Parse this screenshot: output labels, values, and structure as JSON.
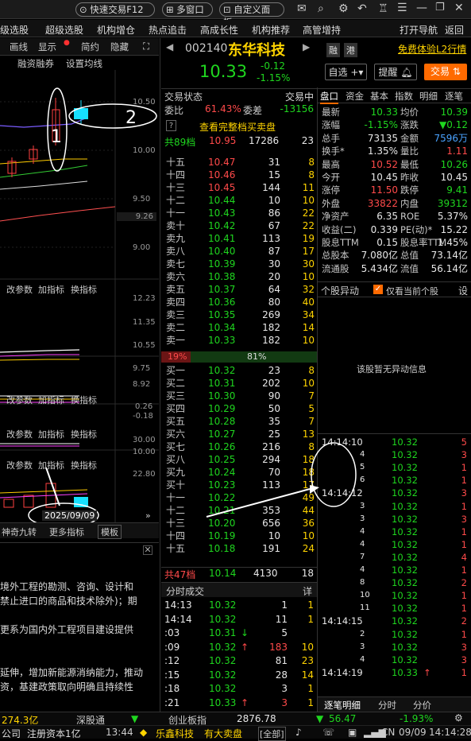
{
  "top": {
    "quick_trade": "快速交易F12",
    "multi_window": "多窗口",
    "custom_panel": "自定义面板"
  },
  "toolbar2": {
    "items": [
      "级选股",
      "超级选股",
      "机构增仓",
      "热点追击",
      "高成长性",
      "机构推荐",
      "高管增持"
    ],
    "open_nav": "打开导航",
    "back": "返回"
  },
  "chart_toolbar": {
    "items": [
      "画线",
      "显示",
      "简约",
      "隐藏"
    ],
    "sub": "融资融券",
    "sub2": "设置均线"
  },
  "chart": {
    "price_ticks": [
      "10.50",
      "10.00",
      "9.50",
      "9.26",
      "9.00"
    ],
    "ind_ticks": [
      "12.23",
      "11.35",
      "10.55",
      "9.75",
      "8.92"
    ],
    "macd_ticks": [
      "0.26",
      "-0.18"
    ],
    "vol_ticks": [
      "30.00",
      "10.00"
    ],
    "vol2_ticks": [
      "22.80"
    ],
    "panel_labels": [
      "改参数",
      "加指标",
      "换指标"
    ],
    "date": "2025/09/09",
    "bottom_left": "神奇九转",
    "more": "更多指标",
    "plate": "模板",
    "annotations": [
      "1",
      "2"
    ]
  },
  "text_panel": {
    "lines": [
      "境外工程的勘测、咨询、设计和",
      "禁止进口的商品和技术除外)；期",
      "",
      "更系为国内外工程项目建设提供",
      "",
      "",
      "延伸，增加新能源消纳能力，推动",
      "资，基建政策取向明确且持续性"
    ]
  },
  "stock": {
    "code": "002140",
    "name": "东华科技",
    "price": "10.33",
    "change": "-0.12",
    "pct": "-1.15%",
    "rong": "融",
    "gang": "港",
    "free_l2": "免费体验L2行情"
  },
  "actions": {
    "watch": "自选",
    "remind": "提醒",
    "trade": "交易"
  },
  "trade_status": {
    "label": "交易状态",
    "value": "交易中"
  },
  "ratio": {
    "weibi_label": "委比",
    "weibi": "61.43%",
    "weicha_label": "委差",
    "weicha": "-13156"
  },
  "view_full": "查看完整档买卖盘",
  "ask_total": {
    "label": "共89档",
    "price": "10.95",
    "vol": "17286",
    "cnt": "23"
  },
  "asks": [
    {
      "l": "十五",
      "p": "10.47",
      "v": "31",
      "c": "8"
    },
    {
      "l": "十四",
      "p": "10.46",
      "v": "15",
      "c": "8"
    },
    {
      "l": "十三",
      "p": "10.45",
      "v": "144",
      "c": "11"
    },
    {
      "l": "十二",
      "p": "10.44",
      "v": "10",
      "c": "10"
    },
    {
      "l": "十一",
      "p": "10.43",
      "v": "86",
      "c": "22"
    },
    {
      "l": "卖十",
      "p": "10.42",
      "v": "67",
      "c": "22"
    },
    {
      "l": "卖九",
      "p": "10.41",
      "v": "113",
      "c": "19"
    },
    {
      "l": "卖八",
      "p": "10.40",
      "v": "87",
      "c": "17"
    },
    {
      "l": "卖七",
      "p": "10.39",
      "v": "30",
      "c": "30"
    },
    {
      "l": "卖六",
      "p": "10.38",
      "v": "20",
      "c": "10"
    },
    {
      "l": "卖五",
      "p": "10.37",
      "v": "64",
      "c": "32"
    },
    {
      "l": "卖四",
      "p": "10.36",
      "v": "80",
      "c": "40"
    },
    {
      "l": "卖三",
      "p": "10.35",
      "v": "269",
      "c": "34"
    },
    {
      "l": "卖二",
      "p": "10.34",
      "v": "182",
      "c": "14"
    },
    {
      "l": "卖一",
      "p": "10.33",
      "v": "182",
      "c": "10"
    }
  ],
  "power": {
    "left": "19%",
    "right": "81%"
  },
  "bids": [
    {
      "l": "买一",
      "p": "10.32",
      "v": "23",
      "c": "8"
    },
    {
      "l": "买二",
      "p": "10.31",
      "v": "202",
      "c": "10"
    },
    {
      "l": "买三",
      "p": "10.30",
      "v": "90",
      "c": "7"
    },
    {
      "l": "买四",
      "p": "10.29",
      "v": "50",
      "c": "5"
    },
    {
      "l": "买五",
      "p": "10.28",
      "v": "35",
      "c": "7"
    },
    {
      "l": "买六",
      "p": "10.27",
      "v": "25",
      "c": "13"
    },
    {
      "l": "买七",
      "p": "10.26",
      "v": "216",
      "c": "8"
    },
    {
      "l": "买八",
      "p": "10.25",
      "v": "294",
      "c": "18"
    },
    {
      "l": "买九",
      "p": "10.24",
      "v": "70",
      "c": "18"
    },
    {
      "l": "买十",
      "p": "10.23",
      "v": "113",
      "c": "17"
    },
    {
      "l": "十一",
      "p": "10.22",
      "v": "",
      "c": "49"
    },
    {
      "l": "十二",
      "p": "10.21",
      "v": "353",
      "c": "44"
    },
    {
      "l": "十三",
      "p": "10.20",
      "v": "656",
      "c": "36"
    },
    {
      "l": "十四",
      "p": "10.19",
      "v": "10",
      "c": "10"
    },
    {
      "l": "十五",
      "p": "10.18",
      "v": "191",
      "c": "24"
    }
  ],
  "bid_total": {
    "label": "共47档",
    "price": "10.14",
    "vol": "4130",
    "cnt": "18"
  },
  "timesales": {
    "title": "分时成交",
    "detail": "详",
    "rows": [
      {
        "t": "14:13",
        "p": "10.32",
        "v": "1",
        "c": "1",
        "pc": "grn"
      },
      {
        "t": "14:14",
        "p": "10.32",
        "v": "11",
        "c": "1",
        "pc": "grn"
      },
      {
        "t": ":03",
        "p": "10.31",
        "v": "5",
        "c": "",
        "pc": "grn",
        "arrow": "down"
      },
      {
        "t": ":09",
        "p": "10.32",
        "v": "183",
        "c": "10",
        "pc": "grn",
        "arrow": "up"
      },
      {
        "t": ":12",
        "p": "10.32",
        "v": "81",
        "c": "23",
        "pc": "grn"
      },
      {
        "t": ":15",
        "p": "10.32",
        "v": "28",
        "c": "14",
        "pc": "grn"
      },
      {
        "t": ":18",
        "p": "10.32",
        "v": "3",
        "c": "1",
        "pc": "grn"
      },
      {
        "t": ":21",
        "p": "10.33",
        "v": "3",
        "c": "1",
        "pc": "grn",
        "arrow": "up"
      }
    ]
  },
  "right_tabs": [
    "盘口",
    "资金",
    "基本",
    "指数",
    "明细",
    "逐笔"
  ],
  "quote": [
    {
      "a": "最新",
      "b": "10.33",
      "bc": "grn",
      "c": "均价",
      "d": "10.39",
      "dc": "grn"
    },
    {
      "a": "涨幅",
      "b": "-1.15%",
      "bc": "grn",
      "c": "涨跌",
      "d": "▼0.12",
      "dc": "grn"
    },
    {
      "a": "总手",
      "b": "73135",
      "bc": "wht",
      "c": "金额",
      "d": "7596万",
      "dc": "blu"
    },
    {
      "a": "换手*",
      "b": "1.35%",
      "bc": "wht",
      "c": "量比",
      "d": "1.11",
      "dc": "red"
    },
    {
      "a": "最高",
      "b": "10.52",
      "bc": "red",
      "c": "最低",
      "d": "10.26",
      "dc": "grn"
    },
    {
      "a": "今开",
      "b": "10.45",
      "bc": "wht",
      "c": "昨收",
      "d": "10.45",
      "dc": "wht"
    },
    {
      "a": "涨停",
      "b": "11.50",
      "bc": "red",
      "c": "跌停",
      "d": "9.41",
      "dc": "grn"
    },
    {
      "a": "外盘",
      "b": "33822",
      "bc": "red",
      "c": "内盘",
      "d": "39312",
      "dc": "grn"
    },
    {
      "a": "净资产",
      "b": "6.35",
      "bc": "wht",
      "c": "ROE",
      "d": "5.37%",
      "dc": "wht"
    },
    {
      "a": "收益(二)",
      "b": "0.339",
      "bc": "wht",
      "c": "PE(动)*",
      "d": "15.22",
      "dc": "wht"
    },
    {
      "a": "股息TTM",
      "b": "0.15",
      "bc": "wht",
      "c": "股息率TTM",
      "d": "1.45%",
      "dc": "wht"
    },
    {
      "a": "总股本",
      "b": "7.080亿",
      "bc": "wht",
      "c": "总值",
      "d": "73.14亿",
      "dc": "wht"
    },
    {
      "a": "流通股",
      "b": "5.434亿",
      "bc": "wht",
      "c": "流值",
      "d": "56.14亿",
      "dc": "wht"
    }
  ],
  "movers": {
    "title": "个股异动",
    "only_current": "仅看当前个股",
    "setting": "设",
    "empty": "该股暂无异动信息"
  },
  "ticks": [
    {
      "t": "14:14:10",
      "p": "10.32",
      "v": "5",
      "vc": "red"
    },
    {
      "t": "4",
      "p": "10.32",
      "v": "3",
      "vc": "red"
    },
    {
      "t": "5",
      "p": "10.32",
      "v": "1",
      "vc": "red"
    },
    {
      "t": "6",
      "p": "10.32",
      "v": "1",
      "vc": "red"
    },
    {
      "t": "14:14:12",
      "p": "10.32",
      "v": "3",
      "vc": "red"
    },
    {
      "t": "3",
      "p": "10.32",
      "v": "1",
      "vc": "red"
    },
    {
      "t": "3",
      "p": "10.32",
      "v": "3",
      "vc": "red"
    },
    {
      "t": "4",
      "p": "10.32",
      "v": "1",
      "vc": "red"
    },
    {
      "t": "4",
      "p": "10.32",
      "v": "1",
      "vc": "red"
    },
    {
      "t": "7",
      "p": "10.32",
      "v": "4",
      "vc": "red"
    },
    {
      "t": "4",
      "p": "10.32",
      "v": "1",
      "vc": "red"
    },
    {
      "t": "8",
      "p": "10.32",
      "v": "2",
      "vc": "red"
    },
    {
      "t": "10",
      "p": "10.32",
      "v": "1",
      "vc": "red"
    },
    {
      "t": "11",
      "p": "10.32",
      "v": "1",
      "vc": "red"
    },
    {
      "t": "14:14:15",
      "p": "10.32",
      "v": "2",
      "vc": "red"
    },
    {
      "t": "2",
      "p": "10.32",
      "v": "1",
      "vc": "red"
    },
    {
      "t": "3",
      "p": "10.32",
      "v": "3",
      "vc": "red"
    },
    {
      "t": "4",
      "p": "10.32",
      "v": "3",
      "vc": "red"
    },
    {
      "t": "14:14:19",
      "p": "10.33",
      "v": "1",
      "vc": "red",
      "arrow": "up"
    }
  ],
  "bottom_tabs": [
    "逐笔明细",
    "分时",
    "分价"
  ],
  "status": {
    "sh": "274.3亿",
    "szt": "深股通",
    "cyb": "创业板指",
    "cyb_val": "2876.78",
    "cyb_chg": "56.47",
    "cyb_pct": "-1.93%"
  },
  "status2": {
    "company": "公司",
    "reg": "注册资本1亿",
    "time": "13:44",
    "name": "乐鑫科技",
    "news": "有大卖盘",
    "all": "[全部]",
    "cn": "CN",
    "date": "09/09",
    "clock": "14:14:28"
  }
}
